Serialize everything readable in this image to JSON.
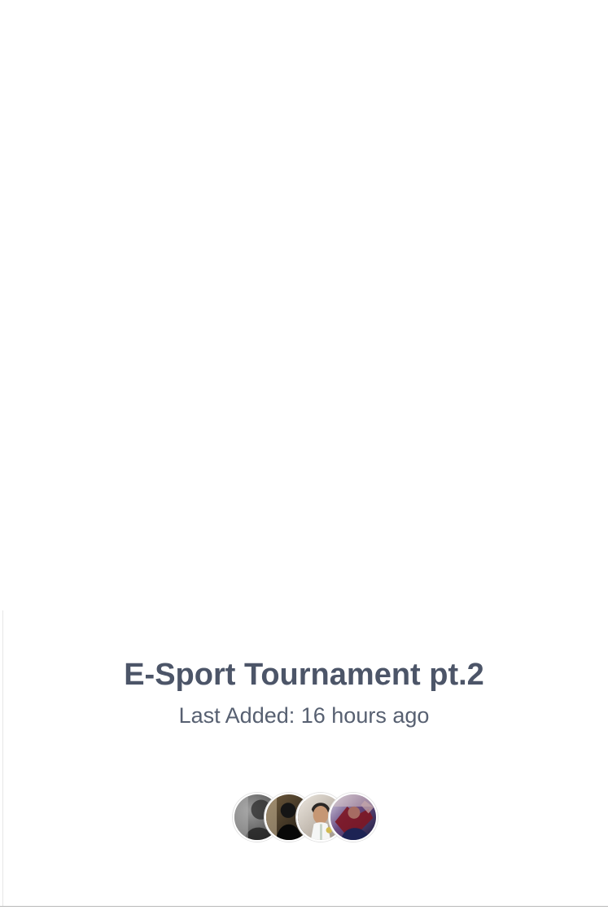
{
  "album": {
    "title": "E-Sport Tournament pt.2",
    "last_added": "Last Added: 16 hours ago",
    "avatars": [
      {
        "name": "avatar-1"
      },
      {
        "name": "avatar-2"
      },
      {
        "name": "avatar-3"
      },
      {
        "name": "avatar-4"
      }
    ]
  },
  "colors": {
    "title_text": "#4c5568",
    "meta_text": "#576071",
    "background": "#ffffff"
  }
}
